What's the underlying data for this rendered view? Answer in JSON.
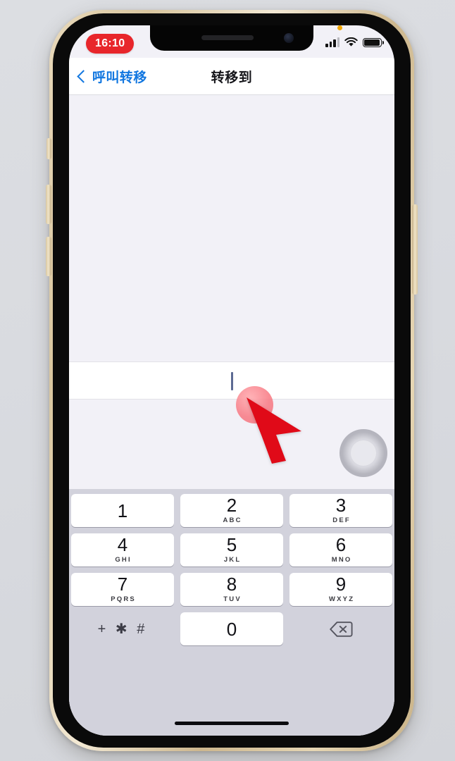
{
  "status_bar": {
    "time": "16:10",
    "recording_pill_color": "#e8262b",
    "mic_indicator": "orange-dot",
    "signal_icon": "cellular-bars-icon",
    "wifi_icon": "wifi-icon",
    "battery_icon": "battery-full-icon"
  },
  "nav": {
    "back_label": "呼叫转移",
    "back_icon": "chevron-left-icon",
    "title": "转移到",
    "accent_color": "#1277e0"
  },
  "field": {
    "value": "",
    "placeholder": ""
  },
  "keyboard": {
    "rows": [
      [
        {
          "digit": "1",
          "letters": ""
        },
        {
          "digit": "2",
          "letters": "ABC"
        },
        {
          "digit": "3",
          "letters": "DEF"
        }
      ],
      [
        {
          "digit": "4",
          "letters": "GHI"
        },
        {
          "digit": "5",
          "letters": "JKL"
        },
        {
          "digit": "6",
          "letters": "MNO"
        }
      ],
      [
        {
          "digit": "7",
          "letters": "PQRS"
        },
        {
          "digit": "8",
          "letters": "TUV"
        },
        {
          "digit": "9",
          "letters": "WXYZ"
        }
      ]
    ],
    "symbols_key": "+ ✱ #",
    "zero_key": "0",
    "delete_icon": "delete-backspace-icon",
    "background_color": "#d2d2dc"
  },
  "overlays": {
    "touch_indicator": "tap-highlight-circle",
    "pointer": "red-arrow-cursor",
    "assistive_touch": "assistive-touch-button",
    "home_indicator": "home-indicator-bar"
  },
  "device": {
    "frame_color": "#ddc9a2",
    "screen_background": "#f2f1f7"
  }
}
